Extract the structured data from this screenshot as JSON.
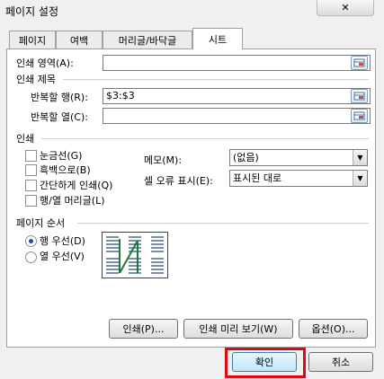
{
  "window": {
    "title": "페이지 설정"
  },
  "tabs": [
    {
      "label": "페이지"
    },
    {
      "label": "여백"
    },
    {
      "label": "머리글/바닥글"
    },
    {
      "label": "시트"
    }
  ],
  "print_area": {
    "label": "인쇄 영역(A):",
    "value": ""
  },
  "print_titles": {
    "heading": "인쇄 제목",
    "rows": {
      "label": "반복할 행(R):",
      "value": "$3:$3"
    },
    "cols": {
      "label": "반복할 열(C):",
      "value": ""
    }
  },
  "print": {
    "heading": "인쇄",
    "gridlines": {
      "label": "눈금선(G)",
      "checked": false
    },
    "bw": {
      "label": "흑백으로(B)",
      "checked": false
    },
    "draft": {
      "label": "간단하게 인쇄(Q)",
      "checked": false
    },
    "headings": {
      "label": "행/열 머리글(L)",
      "checked": false
    },
    "comments": {
      "label": "메모(M):",
      "value": "(없음)"
    },
    "errors": {
      "label": "셀 오류 표시(E):",
      "value": "표시된 대로"
    }
  },
  "page_order": {
    "heading": "페이지 순서",
    "down_then_over": {
      "label": "행 우선(D)",
      "selected": true
    },
    "over_then_down": {
      "label": "열 우선(V)",
      "selected": false
    }
  },
  "buttons": {
    "print": "인쇄(P)...",
    "preview": "인쇄 미리 보기(W)",
    "options": "옵션(O)...",
    "ok": "확인",
    "cancel": "취소"
  },
  "colors": {
    "highlight": "#e30613",
    "radio_dot": "#1a4f99"
  }
}
